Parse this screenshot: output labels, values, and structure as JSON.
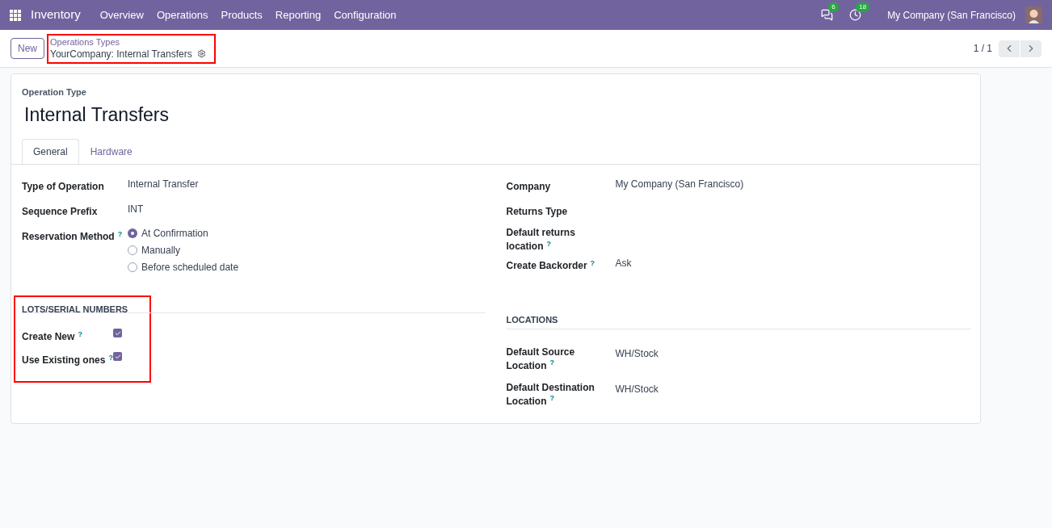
{
  "navbar": {
    "app": "Inventory",
    "menu": [
      "Overview",
      "Operations",
      "Products",
      "Reporting",
      "Configuration"
    ],
    "messages_count": "6",
    "activities_count": "18",
    "company": "My Company (San Francisco)"
  },
  "control_panel": {
    "new_button": "New",
    "breadcrumb_parent": "Operations Types",
    "breadcrumb_current": "YourCompany: Internal Transfers",
    "highlighted": true,
    "pager": "1 / 1"
  },
  "form": {
    "type_label": "Operation Type",
    "name": "Internal Transfers",
    "tabs": [
      {
        "label": "General",
        "selected": true
      },
      {
        "label": "Hardware",
        "selected": false
      }
    ],
    "left_fields": [
      {
        "label": "Type of Operation",
        "value": "Internal Transfer"
      },
      {
        "label": "Sequence Prefix",
        "value": "INT"
      },
      {
        "label": "Reservation Method",
        "help": "?",
        "options": [
          {
            "label": "At Confirmation",
            "selected": true
          },
          {
            "label": "Manually",
            "selected": false
          },
          {
            "label": "Before scheduled date",
            "selected": false
          }
        ]
      }
    ],
    "right_fields": [
      {
        "label": "Company",
        "value": "My Company (San Francisco)"
      },
      {
        "label": "Returns Type"
      },
      {
        "label": "Default returns location",
        "help": "?"
      },
      {
        "label": "Create Backorder",
        "help": "?",
        "value": "Ask"
      }
    ],
    "lots_section": {
      "title": "LOTS/SERIAL NUMBERS",
      "highlighted": true,
      "fields": [
        {
          "label": "Create New",
          "help": "?",
          "checked": true
        },
        {
          "label": "Use Existing ones",
          "help": "?",
          "checked": true
        }
      ]
    },
    "locations_section": {
      "title": "LOCATIONS",
      "fields": [
        {
          "label": "Default Source Location",
          "help": "?",
          "value": "WH/Stock"
        },
        {
          "label": "Default Destination Location",
          "help": "?",
          "value": "WH/Stock"
        }
      ]
    }
  }
}
